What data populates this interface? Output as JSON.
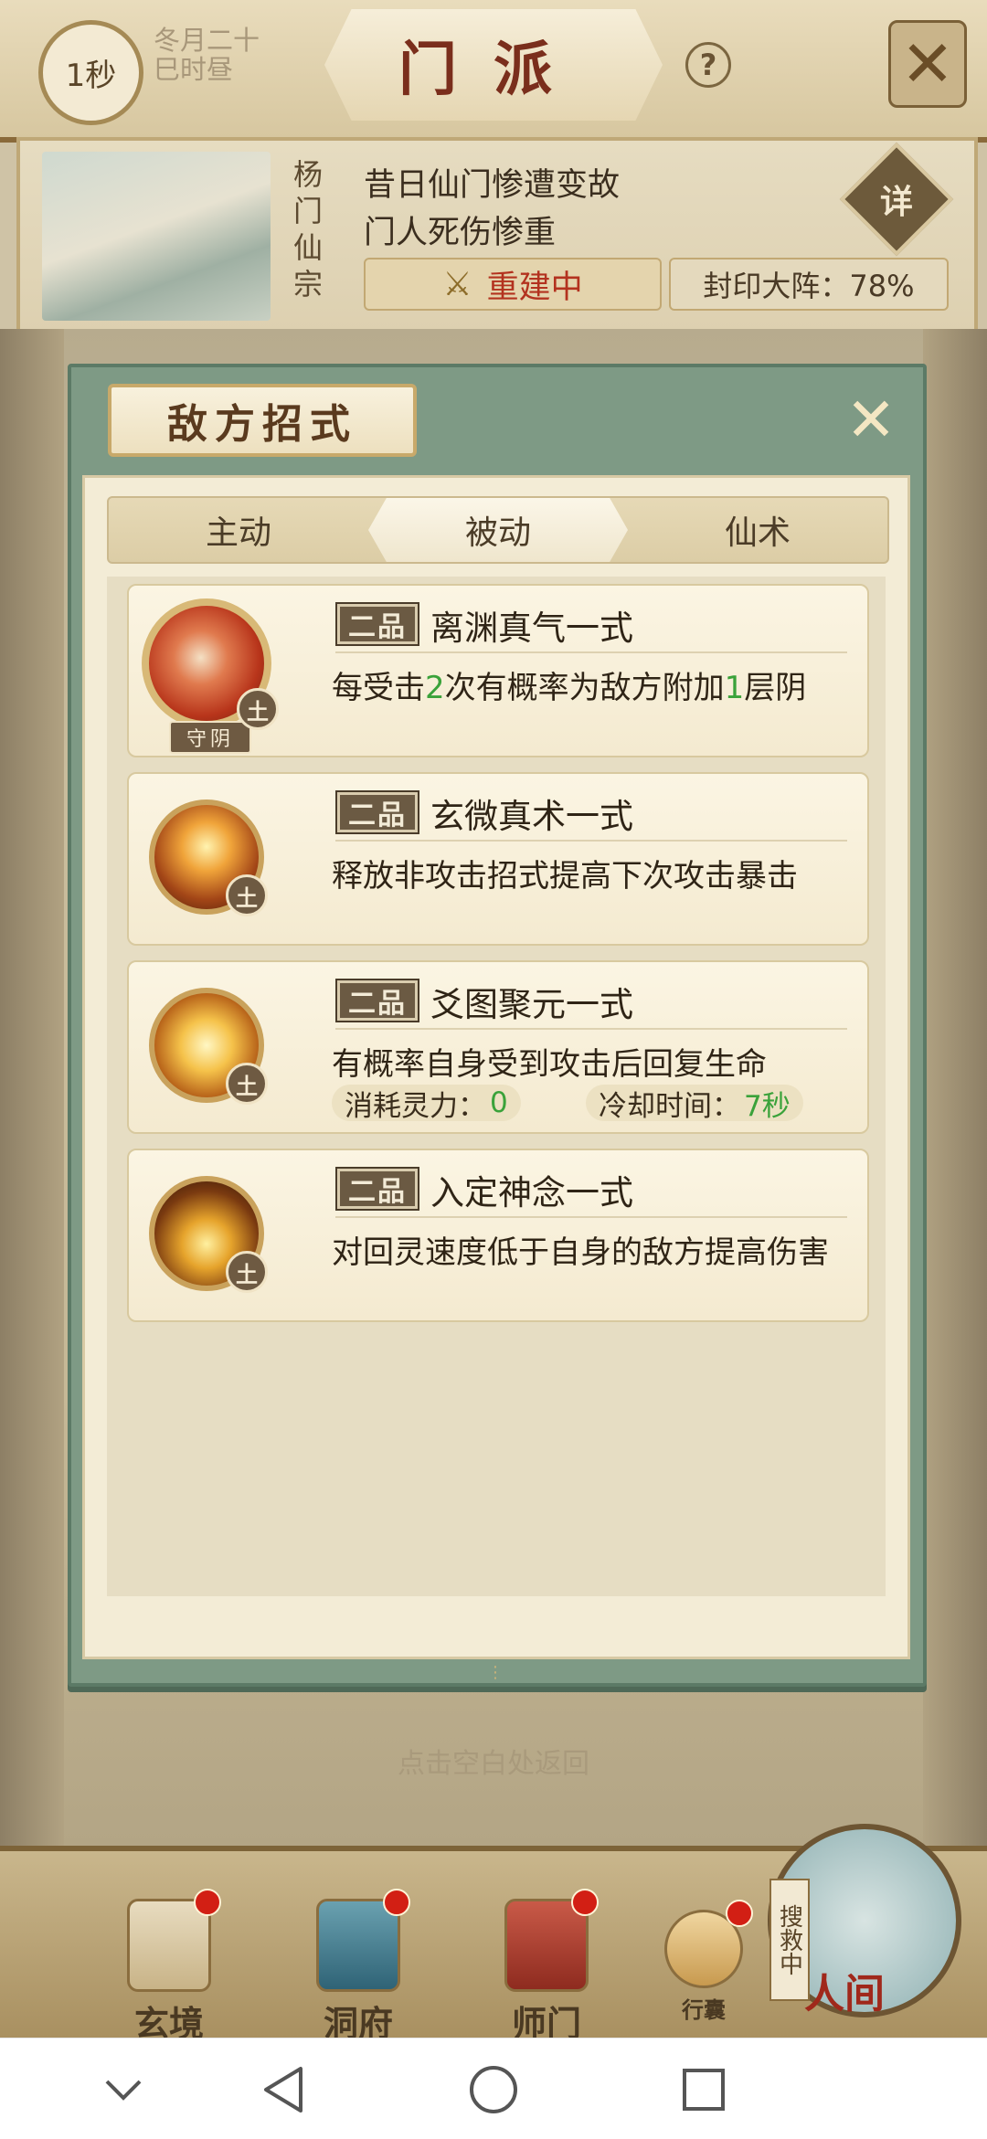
{
  "header": {
    "timer_label": "1秒",
    "date_line1": "冬月二十",
    "date_line2": "巳时昼",
    "title": "门派",
    "help_icon": "?"
  },
  "sect": {
    "name": "杨门仙宗",
    "desc_line1": "昔日仙门惨遭变故",
    "desc_line2": "门人死伤惨重",
    "status": "重建中",
    "seal_label": "封印大阵：78%",
    "seal_progress": 78,
    "detail_button": "详"
  },
  "modal": {
    "title": "敌方招式",
    "tabs": [
      {
        "label": "主动",
        "active": false
      },
      {
        "label": "被动",
        "active": true
      },
      {
        "label": "仙术",
        "active": false
      }
    ],
    "skills": [
      {
        "grade": "二品",
        "name": "离渊真气一式",
        "desc_parts": [
          "每受击",
          "2",
          "次有概率为敌方附加",
          "1",
          "层阴"
        ],
        "element": "土",
        "badge": "守阴",
        "icon": "scroll-skill-icon"
      },
      {
        "grade": "二品",
        "name": "玄微真术一式",
        "desc": "释放非攻击招式提高下次攻击暴击",
        "element": "土",
        "icon": "lightning-figure-icon"
      },
      {
        "grade": "二品",
        "name": "爻图聚元一式",
        "desc": "有概率自身受到攻击后回复生命",
        "element": "土",
        "icon": "golden-talisman-icon",
        "stats": [
          {
            "label": "消耗灵力：",
            "value": "0"
          },
          {
            "label": "冷却时间：",
            "value": "7秒"
          }
        ]
      },
      {
        "grade": "二品",
        "name": "入定神念一式",
        "desc": "对回灵速度低于自身的敌方提高伤害",
        "element": "土",
        "icon": "meditating-figure-icon"
      }
    ]
  },
  "background_hint": "点击空白处返回",
  "bottom_nav": [
    {
      "label": "玄境",
      "badge": true
    },
    {
      "label": "洞府",
      "badge": true
    },
    {
      "label": "师门",
      "badge": true
    },
    {
      "label": "行囊",
      "badge": true
    },
    {
      "label": "人间",
      "badge": false,
      "tag": "搜救中"
    }
  ],
  "colors": {
    "modal_frame": "#7e9a85",
    "panel": "#f3ecd6",
    "highlight_green": "#3aa23a",
    "status_red": "#b3321f"
  }
}
